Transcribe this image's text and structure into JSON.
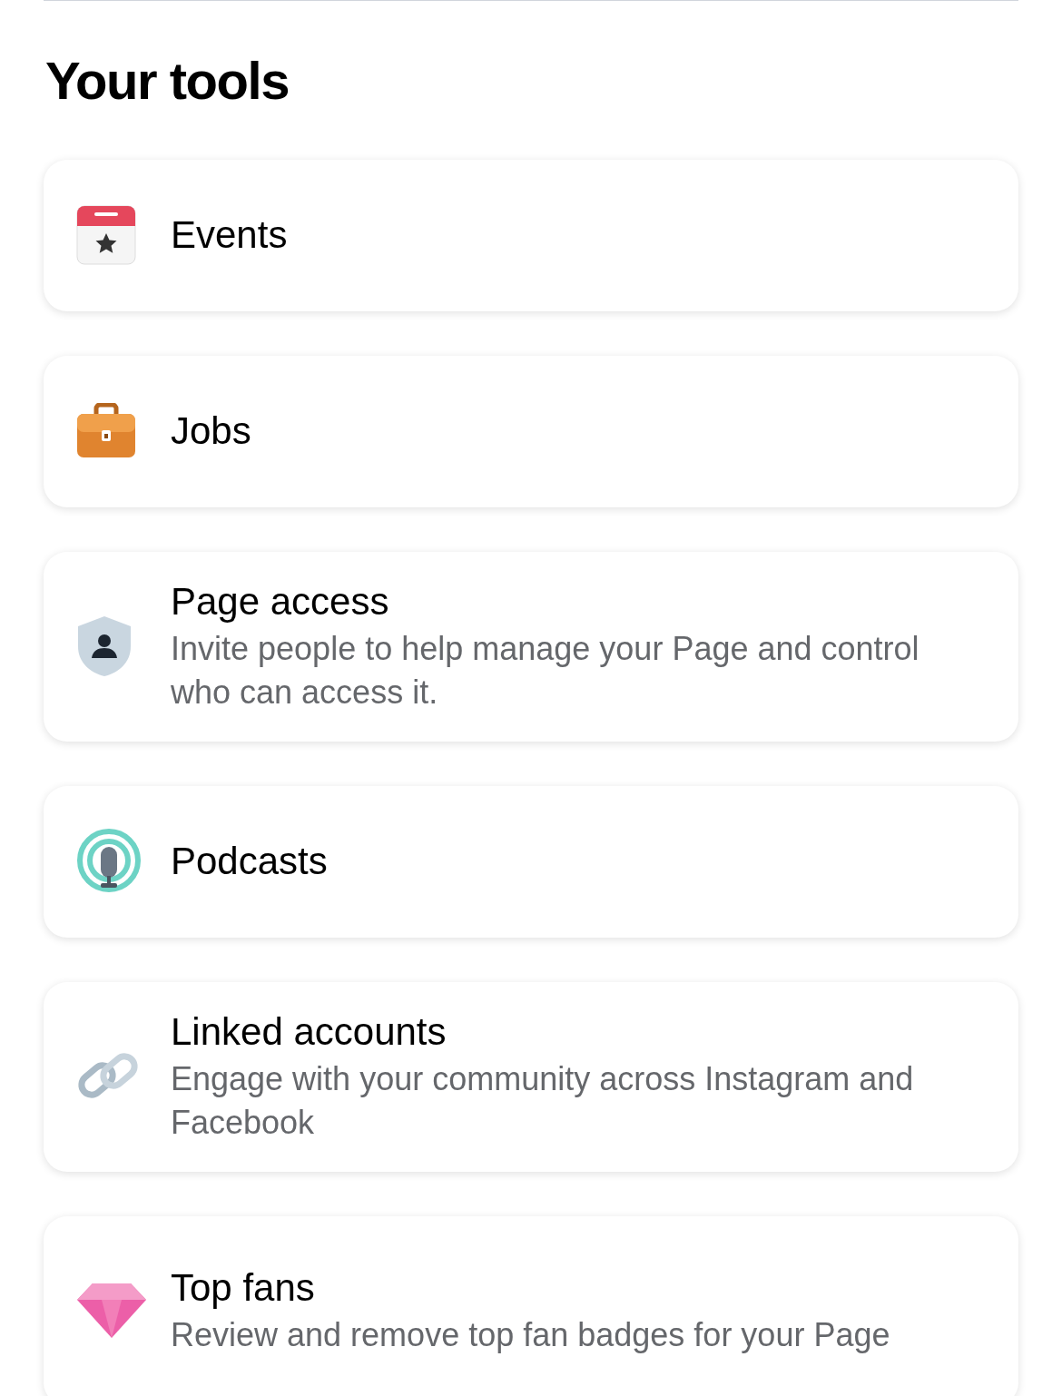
{
  "title": "Your tools",
  "tools": [
    {
      "kind": "events",
      "label": "Events"
    },
    {
      "kind": "jobs",
      "label": "Jobs"
    },
    {
      "kind": "access",
      "label": "Page access",
      "description": "Invite people to help manage your Page and control who can access it."
    },
    {
      "kind": "podcasts",
      "label": "Podcasts"
    },
    {
      "kind": "linked",
      "label": "Linked accounts",
      "description": "Engage with your community across Instagram and Facebook"
    },
    {
      "kind": "fans",
      "label": "Top fans",
      "description": "Review and remove top fan badges for your Page"
    }
  ]
}
